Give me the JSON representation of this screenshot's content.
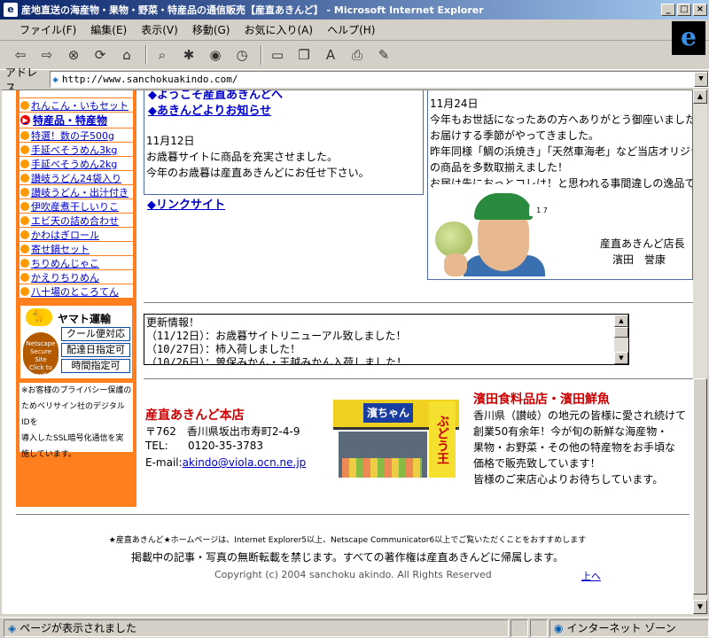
{
  "window": {
    "title": "産地直送の海産物・果物・野菜・特産品の通信販売【産直あきんど】 - Microsoft Internet Explorer",
    "controls": [
      "_",
      "□",
      "×"
    ]
  },
  "menu": [
    "ファイル(F)",
    "編集(E)",
    "表示(V)",
    "移動(G)",
    "お気に入り(A)",
    "ヘルプ(H)"
  ],
  "address": {
    "label": "アドレス",
    "url": "http://www.sanchokuakindo.com/"
  },
  "sidebar": {
    "top_items": [
      "れんこん・いもセット"
    ],
    "category": "特産品・特産物",
    "items": [
      "特選！数の子500g",
      "手延べそうめん3kg",
      "手延べそうめん2kg",
      "讃岐うどん24袋入り",
      "讃岐うどん・出汁付き",
      "伊吹産煮干しいりこ",
      "エビ天の詰め合わせ",
      "かわはぎロール",
      "寄せ鍋セット",
      "ちりめんじゃこ",
      "かえりちりめん",
      "八十場のところてん"
    ],
    "yamato": {
      "title": "ヤマト運輸",
      "services": [
        "クール便対応",
        "配達日指定可",
        "時間指定可"
      ],
      "seal_lines": [
        "Netscape",
        "Secure",
        "Site",
        "Click to verify"
      ]
    },
    "privacy_lines": [
      "※お客様のプライバシー保護の",
      "ためベリサイン社のデジタルIDを",
      "導入したSSL暗号化通信を実",
      "施しています。"
    ]
  },
  "main": {
    "link_top_cut": "◆ようこそ産直あきんどへ",
    "link_news": "◆あきんどよりお知らせ",
    "news": {
      "date": "11月12日",
      "lines": [
        "お歳暮サイトに商品を充実させました。",
        "今年のお歳暮は産直あきんどにお任せ下さい。"
      ]
    },
    "link_sites": "◆リンクサイト",
    "message": {
      "date": "11月24日",
      "lines": [
        "今年もお世話になったあの方へありがとう御座いましたを",
        "お届けする季節がやってきました。",
        "昨年同様「鯛の浜焼き」「天然車海老」など当店オリジナル",
        "の商品を多数取揃えました！",
        "お届け先におっとコレは！と思われる事間違しの逸品です"
      ],
      "manager_title": "産直あきんど店長",
      "manager_name": "濱田　誉康",
      "cap_text": "1 73"
    },
    "updates": {
      "lines": [
        "更新情報！",
        "（11/12日）：お歳暮サイトリニューアル致しました！",
        "（10/27日）：柿入荷しました！",
        "（10/26日）：曽保みかん・王越みかん入荷しました！"
      ]
    },
    "shop": {
      "name": "産直あきんど本店",
      "postal": "〒762　香川県坂出市寿町2-4-9",
      "tel_label": "TEL:",
      "tel": "0120-35-3783",
      "email_label": "E-mail:",
      "email": "akindo@viola.ocn.ne.jp"
    },
    "storefront": {
      "sign": "濱ちゃん",
      "banner": "ぶどう王"
    },
    "shop2": {
      "name": "濱田食料品店・濱田鮮魚",
      "lines": [
        "香川県（讃岐）の地元の皆様に愛され続けて",
        "創業50有余年！今が旬の新鮮な海産物・",
        "果物・お野菜・その他の特産物をお手頃な",
        "価格で販売致しています！",
        "皆様のご来店心よりお待ちしています。"
      ]
    }
  },
  "footer": {
    "note": "★産直あきんど★ホームページは、Internet Explorer5以上、Netscape Communicator6以上でご覧いただくことをおすすめします",
    "rights": "掲載中の記事・写真の無断転載を禁じます。すべての著作権は産直あきんどに帰属します。",
    "copyright": "Copyright (c) 2004 sanchoku akindo. All Rights Reserved",
    "to_top": "上へ"
  },
  "status": {
    "text": "ページが表示されました",
    "zone": "インターネット ゾーン"
  }
}
